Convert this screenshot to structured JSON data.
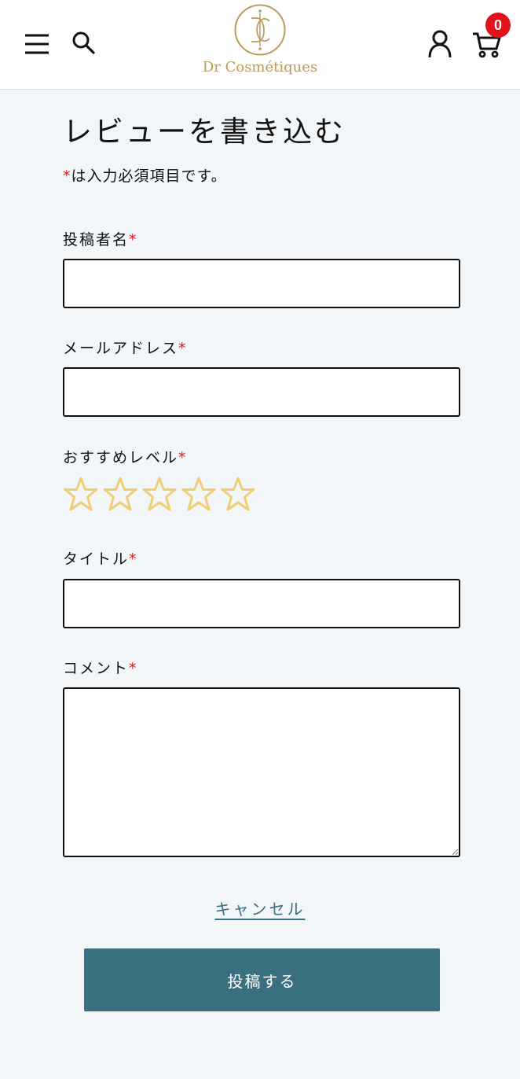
{
  "header": {
    "menu_icon": "hamburger-menu-icon",
    "search_icon": "search-icon",
    "logo_text": "Dr Cosmétiques",
    "account_icon": "user-icon",
    "cart_icon": "cart-icon",
    "cart_count": "0"
  },
  "form": {
    "title": "レビューを書き込む",
    "required_mark": "*",
    "required_note": "は入力必須項目です。",
    "fields": {
      "name_label": "投稿者名",
      "email_label": "メールアドレス",
      "rating_label": "おすすめレベル",
      "title_label": "タイトル",
      "comment_label": "コメント"
    },
    "rating": {
      "max": 5,
      "value": 0,
      "star_color": "#f2cd74"
    },
    "cancel_label": "キャンセル",
    "submit_label": "投稿する"
  },
  "colors": {
    "background": "#f3f6f9",
    "accent": "#3a6f7f",
    "required": "#d71a1a",
    "badge": "#e0131b",
    "logo_gold": "#b99a5b"
  }
}
